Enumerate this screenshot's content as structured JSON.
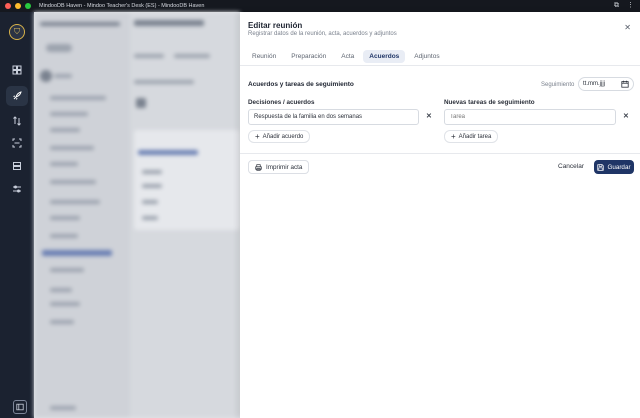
{
  "window": {
    "title": "MindooDB Haven - Mindoo Teacher's Desk (ES) - MindooDB Haven"
  },
  "rail": {
    "items": [
      {
        "icon": "dashboard-icon"
      },
      {
        "icon": "rocket-icon",
        "active": true
      },
      {
        "icon": "transfer-icon"
      },
      {
        "icon": "scan-icon"
      },
      {
        "icon": "database-icon"
      },
      {
        "icon": "sliders-icon"
      }
    ],
    "bottom_icon": "panel-toggle-icon"
  },
  "dialog": {
    "title": "Editar reunión",
    "subtitle": "Registrar datos de la reunión, acta, acuerdos y adjuntos",
    "tabs": [
      {
        "label": "Reunión"
      },
      {
        "label": "Preparación"
      },
      {
        "label": "Acta"
      },
      {
        "label": "Acuerdos",
        "active": true
      },
      {
        "label": "Adjuntos"
      }
    ],
    "section_title": "Acuerdos y tareas de seguimiento",
    "follow_up": {
      "label": "Seguimiento",
      "value": "tt.mm.jjjj"
    },
    "decisions": {
      "label": "Decisiones / acuerdos",
      "value": "Respuesta de la familia en dos semanas",
      "add_label": "Añadir acuerdo"
    },
    "tasks": {
      "label": "Nuevas tareas de seguimiento",
      "placeholder": "Tarea",
      "add_label": "Añadir tarea"
    },
    "footer": {
      "print_label": "Imprimir acta",
      "cancel_label": "Cancelar",
      "save_label": "Guardar"
    }
  },
  "colors": {
    "accent": "#1f3566",
    "rail_bg": "#1b2230",
    "active_tab_bg": "#e9edf5"
  }
}
